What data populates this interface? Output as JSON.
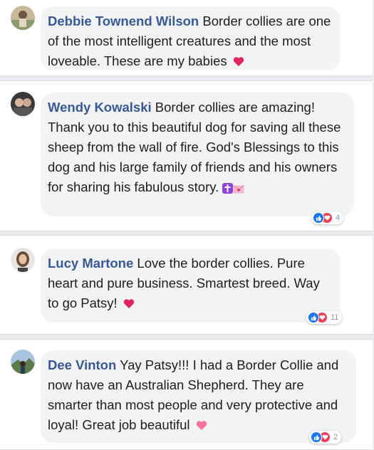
{
  "comments": [
    {
      "author": "Debbie Townend Wilson",
      "text": "Border collies are one of the most intelligent creatures and the most loveable. These are my babies",
      "emoji": "red-heart-icon"
    },
    {
      "author": "Wendy Kowalski",
      "text": "Border collies are amazing! Thank you to this beautiful dog for saving all these sheep from the wall of fire. God's Blessings to this dog and his large family of friends and his owners for sharing his fabulous story.",
      "emoji": "cross-and-love-letter-icons",
      "reaction_count": "4"
    },
    {
      "author": "Lucy Martone",
      "text": "Love the border collies. Pure heart and pure business. Smartest breed. Way to go Patsy!",
      "emoji": "red-heart-icon",
      "reaction_count": "11"
    },
    {
      "author": "Dee Vinton",
      "text": "Yay Patsy!!! I had a Border Collie and now have an Australian Shepherd. They are smarter than most people and very protective and loyal! Great job beautiful",
      "emoji": "pink-heart-icon",
      "reaction_count": "2"
    }
  ],
  "colors": {
    "author_name": "#385898",
    "bubble": "#f2f3f5",
    "background": "#e9ebee",
    "like": "#1877f2",
    "love": "#f33e58"
  }
}
